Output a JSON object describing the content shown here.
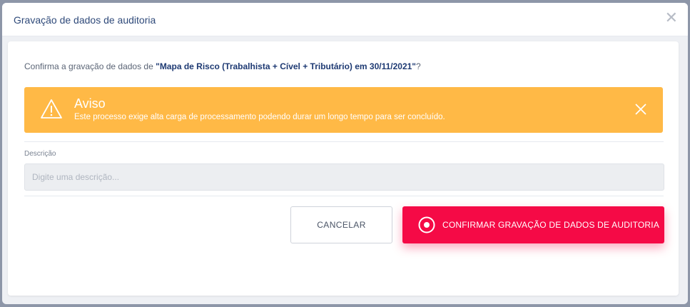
{
  "modal": {
    "title": "Gravação de dados de auditoria",
    "close_icon": "close-icon"
  },
  "confirm": {
    "prefix": "Confirma a gravação de dados de ",
    "highlight": "\"Mapa de Risco (Trabalhista + Cível + Tributário) em 30/11/2021\"",
    "suffix": "?"
  },
  "alert": {
    "icon": "warning-icon",
    "title": "Aviso",
    "message": "Este processo exige alta carga de processamento podendo durar um longo tempo para ser concluído.",
    "color": "#ffb946"
  },
  "description": {
    "label": "Descrição",
    "placeholder": "Digite uma descrição...",
    "value": ""
  },
  "buttons": {
    "cancel_label": "CANCELAR",
    "confirm_label": "CONFIRMAR GRAVAÇÃO DE DADOS DE AUDITORIA",
    "confirm_color": "#f50a46"
  }
}
